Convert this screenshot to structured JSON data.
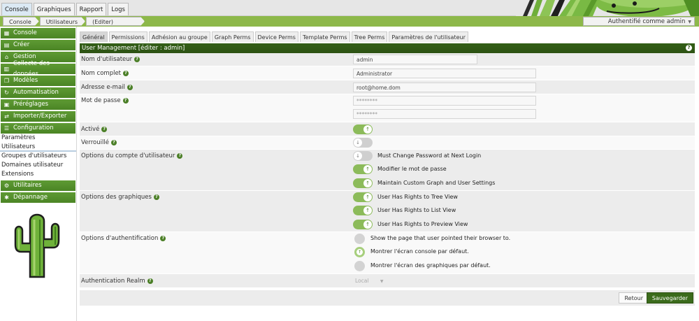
{
  "top_tabs": [
    "Console",
    "Graphiques",
    "Rapport",
    "Logs"
  ],
  "breadcrumb": [
    "Console",
    "Utilisateurs",
    "(Editer)"
  ],
  "auth_label": "Authentifié comme admin",
  "sidebar": {
    "groups_top": [
      {
        "label": "Console",
        "icon": "map-icon"
      },
      {
        "label": "Créer",
        "icon": "chart-icon"
      },
      {
        "label": "Gestion",
        "icon": "home-icon"
      },
      {
        "label": "Collecte des données",
        "icon": "database-icon"
      },
      {
        "label": "Modèles",
        "icon": "template-icon"
      },
      {
        "label": "Automatisation",
        "icon": "automation-icon"
      },
      {
        "label": "Préréglages",
        "icon": "presets-icon"
      },
      {
        "label": "Importer/Exporter",
        "icon": "import-export-icon"
      },
      {
        "label": "Configuration",
        "icon": "configuration-icon"
      }
    ],
    "config_items": [
      "Paramètres",
      "Utilisateurs",
      "Groupes d'utilisateurs",
      "Domaines utilisateur",
      "Extensions"
    ],
    "groups_bottom": [
      {
        "label": "Utilitaires",
        "icon": "utilities-icon"
      },
      {
        "label": "Dépannage",
        "icon": "bug-icon"
      }
    ]
  },
  "subtabs": [
    "Général",
    "Permissions",
    "Adhésion au groupe",
    "Graph Perms",
    "Device Perms",
    "Template Perms",
    "Tree Perms",
    "Paramètres de l'utilisateur"
  ],
  "panel_title": "User Management [éditer : admin]",
  "form": {
    "username_label": "Nom d'utilisateur",
    "username_value": "admin",
    "fullname_label": "Nom complet",
    "fullname_value": "Administrator",
    "email_label": "Adresse e-mail",
    "email_value": "root@home.dom",
    "password_label": "Mot de passe",
    "password_value": "********",
    "password_confirm_value": "********",
    "enabled_label": "Activé",
    "locked_label": "Verrouillé",
    "account_options_label": "Options du compte d'utilisateur",
    "account_options": [
      "Must Change Password at Next Login",
      "Modifier le mot de passe",
      "Maintain Custom Graph and User Settings"
    ],
    "graph_options_label": "Options des graphiques",
    "graph_options": [
      "User Has Rights to Tree View",
      "User Has Rights to List View",
      "User Has Rights to Preview View"
    ],
    "auth_options_label": "Options d'authentification",
    "auth_options": [
      "Show the page that user pointed their browser to.",
      "Montrer l'écran console par défaut.",
      "Montrer l'écran des graphiques par défaut."
    ],
    "realm_label": "Authentication Realm",
    "realm_value": "Local"
  },
  "buttons": {
    "back": "Retour",
    "save": "Sauvegarder"
  }
}
